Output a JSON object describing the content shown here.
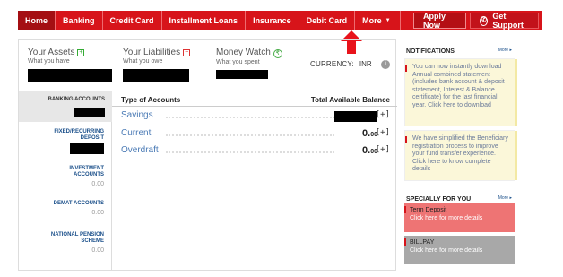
{
  "nav": {
    "items": [
      {
        "label": "Home",
        "active": true
      },
      {
        "label": "Banking"
      },
      {
        "label": "Credit Card"
      },
      {
        "label": "Installment Loans"
      },
      {
        "label": "Insurance"
      },
      {
        "label": "Debit Card"
      },
      {
        "label": "More"
      }
    ],
    "apply_label": "Apply Now",
    "support_label": "Get Support"
  },
  "summary": {
    "assets_title": "Your Assets",
    "assets_sub": "What you have",
    "liabilities_title": "Your Liabilities",
    "liabilities_sub": "What you owe",
    "money_watch_title": "Money Watch",
    "money_watch_sub": "What you spent",
    "currency_label": "CURRENCY:",
    "currency_value": "INR"
  },
  "left_nav": {
    "banking": "BANKING ACCOUNTS",
    "fixed": "FIXED/RECURRING DEPOSIT",
    "investment": "INVESTMENT ACCOUNTS",
    "investment_value": "0.00",
    "demat": "DEMAT ACCOUNTS",
    "demat_value": "0.00",
    "pension": "NATIONAL PENSION SCHEME",
    "pension_value": "0.00"
  },
  "accounts": {
    "type_header": "Type of Accounts",
    "balance_header": "Total Available Balance",
    "rows": [
      {
        "name": "Savings",
        "amount_int": "",
        "amount_dec": "",
        "toggle": "[+]"
      },
      {
        "name": "Current",
        "amount_int": "0.",
        "amount_dec": "00",
        "toggle": "[+]"
      },
      {
        "name": "Overdraft",
        "amount_int": "0.",
        "amount_dec": "00",
        "toggle": "[+]"
      }
    ]
  },
  "notifications": {
    "title": "NOTIFICATIONS",
    "more": "More",
    "items": [
      "You can now instantly download Annual combined statement (includes bank account & deposit statement, Interest & Balance certificate) for the last financial year. Click here to download",
      "We have simplified the Beneficiary registration process to improve your fund transfer experience. Click here to know complete details"
    ]
  },
  "special": {
    "title": "SPECIALLY FOR YOU",
    "more": "More",
    "items": [
      {
        "title": "Term Deposit",
        "sub": "Click here for more details",
        "color": "#ee7474"
      },
      {
        "title": "BILLPAY",
        "sub": "Click here for more details",
        "color": "#a8a8a8"
      }
    ]
  },
  "colors": {
    "brand_red": "#d7141a",
    "link_blue": "#4a7ab5"
  }
}
